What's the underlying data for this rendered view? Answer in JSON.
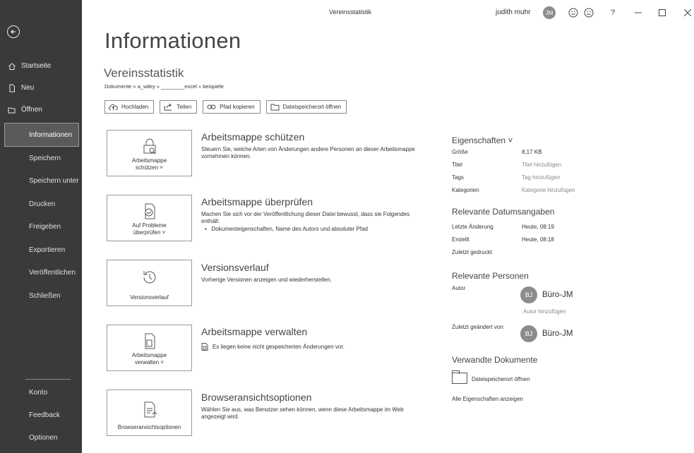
{
  "window": {
    "title": "Vereinsstatistik",
    "user_name": "judith muhr",
    "user_initials": "JM"
  },
  "sidebar": {
    "top_items": [
      {
        "label": "Startseite",
        "icon": "home-icon"
      },
      {
        "label": "Neu",
        "icon": "new-document-icon"
      },
      {
        "label": "Öffnen",
        "icon": "folder-open-icon"
      }
    ],
    "nav_items": [
      {
        "label": "Informationen",
        "selected": true
      },
      {
        "label": "Speichern"
      },
      {
        "label": "Speichern unter"
      },
      {
        "label": "Drucken"
      },
      {
        "label": "Freigeben"
      },
      {
        "label": "Exportieren"
      },
      {
        "label": "Veröffentlichen"
      },
      {
        "label": "Schließen"
      }
    ],
    "bottom_items": [
      {
        "label": "Konto"
      },
      {
        "label": "Feedback"
      },
      {
        "label": "Optionen"
      }
    ]
  },
  "main": {
    "title": "Informationen",
    "doc_name": "Vereinsstatistik",
    "breadcrumb": "Dokumente » a_wiley » ________excel » beispiele",
    "toolbar": {
      "upload": "Hochladen",
      "share": "Teilen",
      "copy_path": "Pfad kopieren",
      "open_location": "Dateispeicherort öffnen"
    },
    "sections": [
      {
        "button_line1": "Arbeitsmappe",
        "button_line2": "schützen ˅",
        "title": "Arbeitsmappe schützen",
        "description": "Steuern Sie, welche Arten von Änderungen andere Personen an dieser Arbeitsmappe vornehmen können."
      },
      {
        "button_line1": "Auf Probleme",
        "button_line2": "überprüfen ˅",
        "title": "Arbeitsmappe überprüfen",
        "description": "Machen Sie sich vor der Veröffentlichung dieser Datei bewusst, dass sie Folgendes enthält:",
        "bullet": "Dokumenteigenschaften, Name des Autors und absoluter Pfad"
      },
      {
        "button_line1": "Versionsverlauf",
        "title": "Versionsverlauf",
        "description": "Vorherige Versionen anzeigen und wiederherstellen."
      },
      {
        "button_line1": "Arbeitsmappe",
        "button_line2": "verwalten ˅",
        "title": "Arbeitsmappe verwalten",
        "description": "Es liegen keine nicht gespeicherten Änderungen vor."
      },
      {
        "button_line1": "Browseransichtsoptionen",
        "title": "Browseransichtsoptionen",
        "description": "Wählen Sie aus, was Benutzer sehen können, wenn diese Arbeitsmappe im Web angezeigt wird."
      }
    ]
  },
  "properties": {
    "heading": "Eigenschaften ˅",
    "rows": [
      {
        "key": "Größe",
        "value": "8,17 KB",
        "muted": false
      },
      {
        "key": "Titel",
        "value": "Titel hinzufügen",
        "muted": true
      },
      {
        "key": "Tags",
        "value": "Tag hinzufügen",
        "muted": true
      },
      {
        "key": "Kategorien",
        "value": "Kategorie hinzufügen",
        "muted": true
      }
    ],
    "dates_heading": "Relevante Datumsangaben",
    "dates": [
      {
        "key": "Letzte Änderung",
        "value": "Heute, 08:19"
      },
      {
        "key": "Erstellt",
        "value": "Heute, 08:18"
      },
      {
        "key": "Zuletzt gedruckt",
        "value": ""
      }
    ],
    "people_heading": "Relevante Personen",
    "author_label": "Autor",
    "author_initials": "BJ",
    "author_name": "Büro-JM",
    "add_author": "Autor hinzufügen",
    "last_modified_label": "Zuletzt geändert von",
    "modifier_initials": "BJ",
    "modifier_name": "Büro-JM",
    "related_heading": "Verwandte Dokumente",
    "open_location": "Dateispeicherort öffnen",
    "show_all": "Alle Eigenschaften anzeigen"
  }
}
